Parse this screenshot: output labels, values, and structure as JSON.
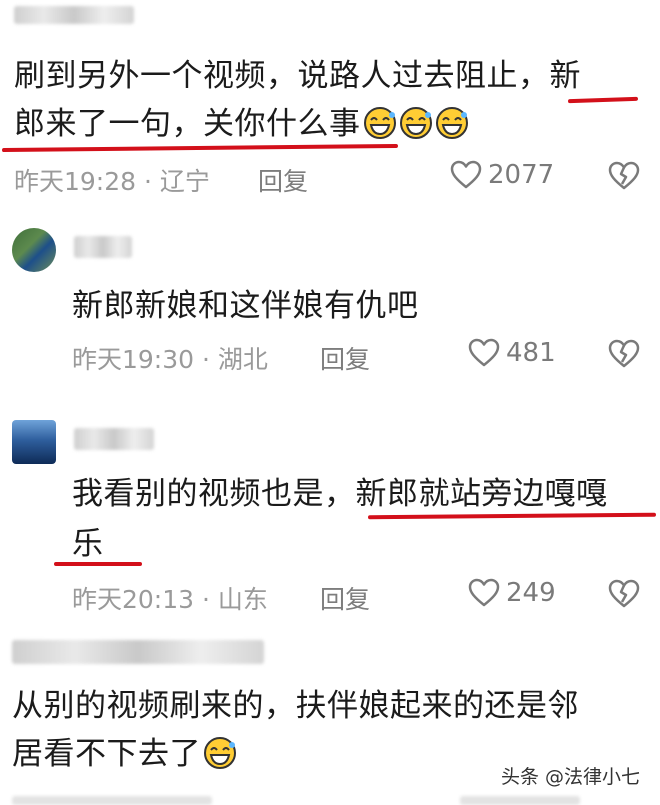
{
  "comments": [
    {
      "text_line1": "刷到另外一个视频，说路人过去阻止，新",
      "text_line2": "郎来了一句，关你什么事",
      "time": "昨天19:28",
      "location": "辽宁",
      "reply_label": "回复",
      "likes": "2077"
    },
    {
      "text_line1": "新郎新娘和这伴娘有仇吧",
      "time": "昨天19:30",
      "location": "湖北",
      "reply_label": "回复",
      "likes": "481"
    },
    {
      "text_line1": "我看别的视频也是，新郎就站旁边嘎嘎",
      "text_line2": "乐",
      "time": "昨天20:13",
      "location": "山东",
      "reply_label": "回复",
      "likes": "249"
    },
    {
      "text_line1": "从别的视频刷来的，扶伴娘起来的还是邻",
      "text_line2": "居看不下去了"
    }
  ],
  "separator": "·",
  "watermark": "头条 @法律小七",
  "colors": {
    "underline": "#d3101a",
    "meta": "#9a9a9a"
  },
  "icons": [
    "heart-icon",
    "dislike-heart-icon",
    "laughing-emoji-icon"
  ]
}
